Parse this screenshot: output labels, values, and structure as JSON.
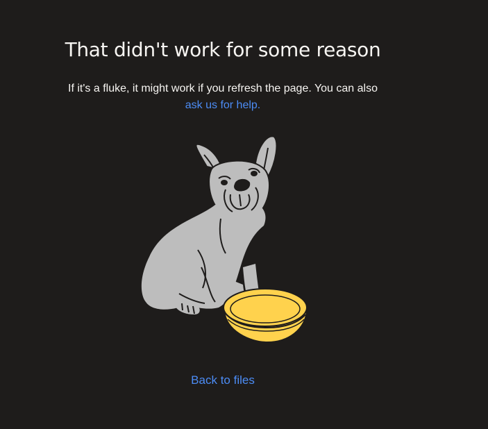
{
  "error": {
    "title": "That didn't work for some reason",
    "message_text": "If it's a fluke, it might work if you refresh the page. You can also",
    "help_link": "ask us for help.",
    "back_link": "Back to files"
  },
  "illustration": {
    "icon": "sad-dog-with-empty-bowl-illustration"
  },
  "colors": {
    "background": "#1e1c1b",
    "text": "#f7f5f2",
    "link": "#4c8cf5",
    "dog": "#bdbdbd",
    "bowl": "#ffd24d"
  }
}
